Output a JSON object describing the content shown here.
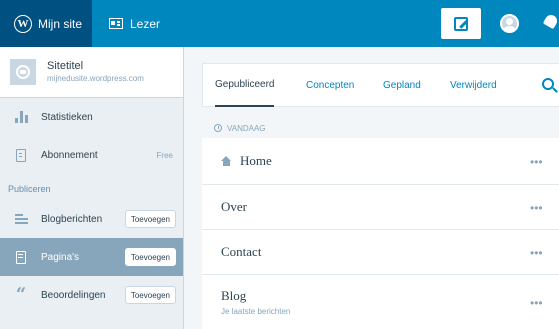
{
  "topbar": {
    "my_site_label": "Mijn site",
    "reader_label": "Lezer",
    "accent": "#0087be"
  },
  "sidebar": {
    "site_title": "Sitetitel",
    "site_url": "mijnedusite.wordpress.com",
    "items": [
      {
        "label": "Statistieken",
        "icon": "stats-icon"
      },
      {
        "label": "Abonnement",
        "icon": "plan-icon",
        "badge": "Free"
      }
    ],
    "section_label": "Publiceren",
    "publish_items": [
      {
        "label": "Blogberichten",
        "icon": "posts-icon",
        "add_label": "Toevoegen"
      },
      {
        "label": "Pagina's",
        "icon": "pages-icon",
        "add_label": "Toevoegen",
        "active": true
      },
      {
        "label": "Beoordelingen",
        "icon": "testimonials-icon",
        "add_label": "Toevoegen"
      }
    ]
  },
  "main": {
    "tabs": [
      {
        "label": "Gepubliceerd",
        "selected": true
      },
      {
        "label": "Concepten"
      },
      {
        "label": "Gepland"
      },
      {
        "label": "Verwijderd"
      }
    ],
    "group_label": "VANDAAG",
    "pages": [
      {
        "title": "Home",
        "icon": "home-icon"
      },
      {
        "title": "Over"
      },
      {
        "title": "Contact"
      },
      {
        "title": "Blog",
        "subtitle": "Je laatste berichten"
      }
    ],
    "more_glyph": "•••"
  }
}
